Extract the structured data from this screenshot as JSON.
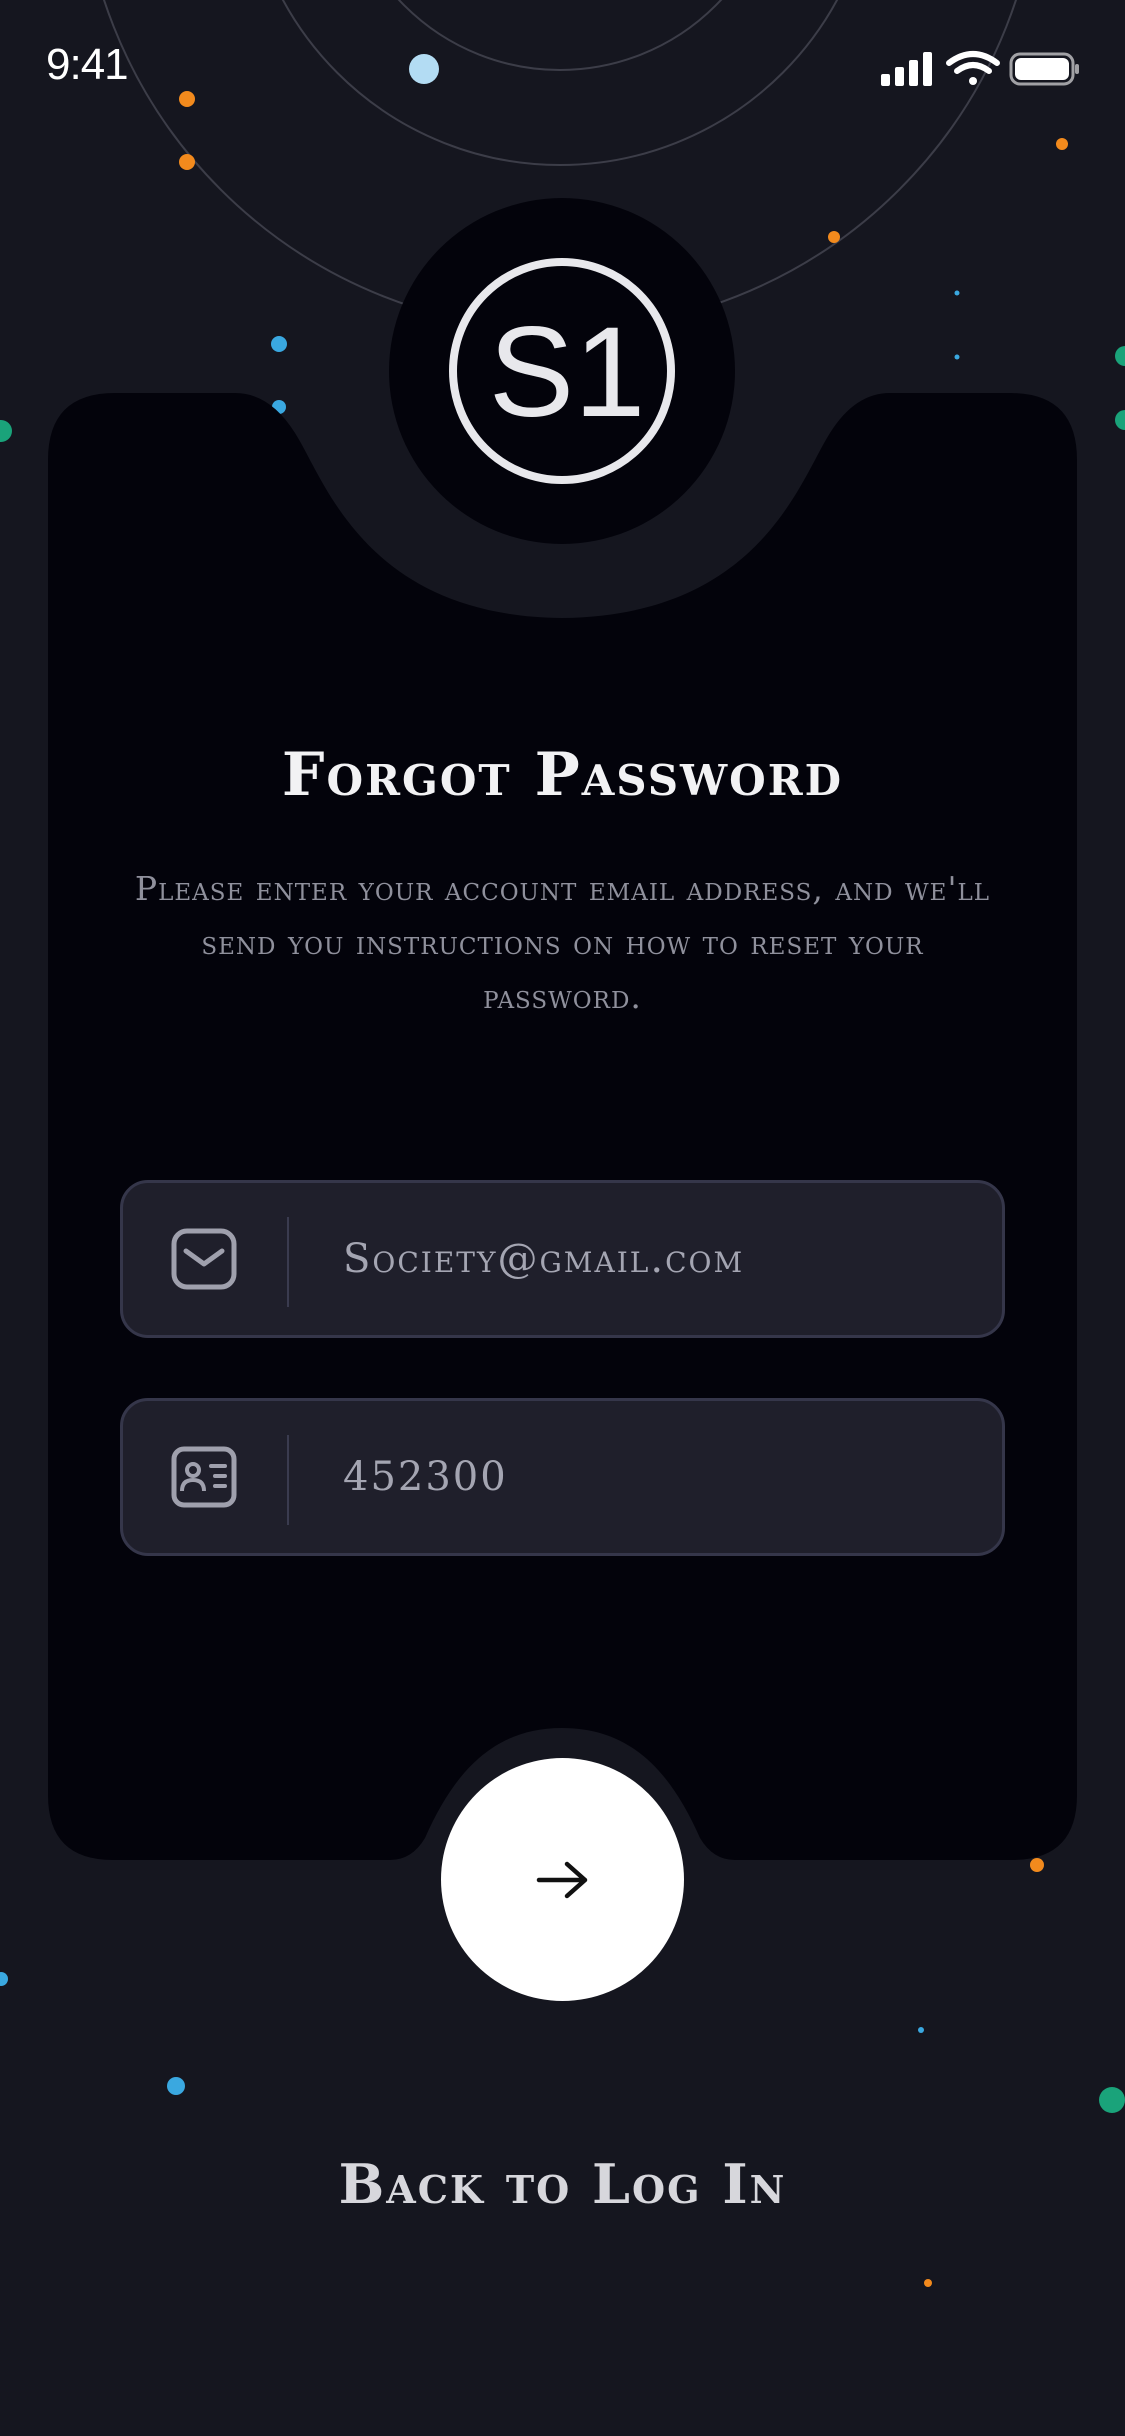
{
  "status_bar": {
    "time": "9:41"
  },
  "logo": {
    "text": "S1"
  },
  "title": "Forgot Password",
  "subtitle": "Please enter your account email address, and we'll send you instructions on how to reset your password.",
  "email_field": {
    "value": "Society@gmail.com",
    "icon": "envelope-icon"
  },
  "code_field": {
    "value": "452300",
    "icon": "id-card-icon"
  },
  "submit": {
    "icon": "arrow-right-icon"
  },
  "back_link": "Back to Log In",
  "colors": {
    "background": "#15161f",
    "card": "#03030b",
    "field": "#1f1f2b",
    "accent_orange": "#f28a1d",
    "accent_blue": "#3aa8e0",
    "accent_light_blue": "#b3dcf3",
    "accent_teal": "#1aa37a"
  }
}
